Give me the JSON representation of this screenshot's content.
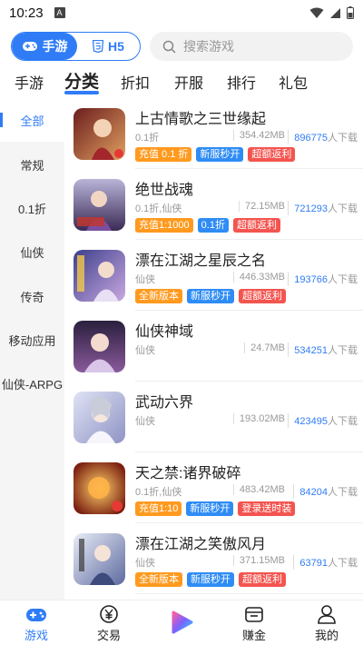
{
  "status": {
    "time": "10:23",
    "sim": "A"
  },
  "toggle": {
    "active_label": "手游",
    "other_label": "H5"
  },
  "search": {
    "placeholder": "搜索游戏"
  },
  "tabs": [
    "手游",
    "分类",
    "折扣",
    "开服",
    "排行",
    "礼包"
  ],
  "sidebar": {
    "items": [
      "全部",
      "常规",
      "0.1折",
      "仙侠",
      "传奇",
      "移动应用",
      "仙侠-ARPG"
    ]
  },
  "games": [
    {
      "name": "上古情歌之三世缘起",
      "category": "0.1折",
      "size": "354.42MB",
      "downloads": "896775",
      "dl_suffix": "人下载",
      "tags": [
        {
          "text": "充值 0.1 折",
          "color": "orange"
        },
        {
          "text": "新服秒开",
          "color": "blue"
        },
        {
          "text": "超额返利",
          "color": "red"
        }
      ]
    },
    {
      "name": "绝世战魂",
      "category": "0.1折,仙侠",
      "size": "72.15MB",
      "downloads": "721293",
      "dl_suffix": "人下载",
      "tags": [
        {
          "text": "充值1:1000",
          "color": "orange"
        },
        {
          "text": "0.1折",
          "color": "blue"
        },
        {
          "text": "超额返利",
          "color": "red"
        }
      ]
    },
    {
      "name": "漂在江湖之星辰之名",
      "category": "仙侠",
      "size": "446.33MB",
      "downloads": "193766",
      "dl_suffix": "人下载",
      "tags": [
        {
          "text": "全新版本",
          "color": "orange"
        },
        {
          "text": "新服秒开",
          "color": "blue"
        },
        {
          "text": "超额返利",
          "color": "red"
        }
      ]
    },
    {
      "name": "仙侠神域",
      "category": "仙侠",
      "size": "24.7MB",
      "downloads": "534251",
      "dl_suffix": "人下载",
      "tags": []
    },
    {
      "name": "武动六界",
      "category": "仙侠",
      "size": "193.02MB",
      "downloads": "423495",
      "dl_suffix": "人下载",
      "tags": []
    },
    {
      "name": "天之禁:诸界破碎",
      "category": "0.1折,仙侠",
      "size": "483.42MB",
      "downloads": "84204",
      "dl_suffix": "人下载",
      "tags": [
        {
          "text": "充值1:10",
          "color": "orange"
        },
        {
          "text": "新服秒开",
          "color": "blue"
        },
        {
          "text": "登录送时装",
          "color": "red"
        }
      ]
    },
    {
      "name": "漂在江湖之笑傲风月",
      "category": "仙侠",
      "size": "371.15MB",
      "downloads": "63791",
      "dl_suffix": "人下载",
      "tags": [
        {
          "text": "全新版本",
          "color": "orange"
        },
        {
          "text": "新服秒开",
          "color": "blue"
        },
        {
          "text": "超额返利",
          "color": "red"
        }
      ]
    }
  ],
  "bottom_nav": [
    "游戏",
    "交易",
    "",
    "赚金",
    "我的"
  ],
  "colors": {
    "accent": "#2f7cf6",
    "tag_orange": "#ff9a1f",
    "tag_blue": "#2f8cf5",
    "tag_red": "#f4544f"
  }
}
